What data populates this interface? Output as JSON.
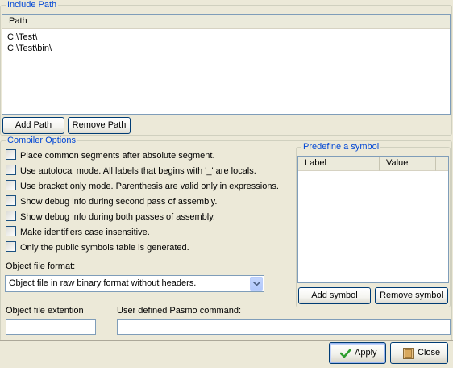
{
  "include_path": {
    "title": "Include Path",
    "column_header": "Path",
    "paths": [
      "C:\\Test\\",
      "C:\\Test\\bin\\"
    ],
    "add_label": "Add Path",
    "remove_label": "Remove Path"
  },
  "compiler_options": {
    "title": "Compiler Options",
    "options": [
      {
        "label": "Place common segments after absolute segment.",
        "checked": false
      },
      {
        "label": "Use autolocal mode. All labels that begins with '_' are locals.",
        "checked": false
      },
      {
        "label": "Use bracket only mode. Parenthesis are valid only in expressions.",
        "checked": false
      },
      {
        "label": "Show debug info during second pass of assembly.",
        "checked": false
      },
      {
        "label": "Show debug info during both passes of assembly.",
        "checked": false
      },
      {
        "label": "Make identifiers case insensitive.",
        "checked": false
      },
      {
        "label": "Only the public symbols table is generated.",
        "checked": false
      }
    ],
    "object_format_label": "Object file format:",
    "object_format_value": "Object file in raw binary format without headers.",
    "extension_label": "Object file extention",
    "extension_value": "",
    "command_label": "User defined Pasmo command:",
    "command_value": ""
  },
  "predefine": {
    "title": "Predefine a symbol",
    "col_label": "Label",
    "col_value": "Value",
    "add_label": "Add symbol",
    "remove_label": "Remove symbol"
  },
  "footer": {
    "apply_label": "Apply",
    "close_label": "Close"
  },
  "colors": {
    "legend": "#0046d5",
    "dialog_bg": "#ece9d8",
    "apply_check": "#2e9e2e"
  },
  "icons": {
    "apply": "check-icon",
    "close": "close-door-icon",
    "combo": "chevron-down-icon"
  }
}
